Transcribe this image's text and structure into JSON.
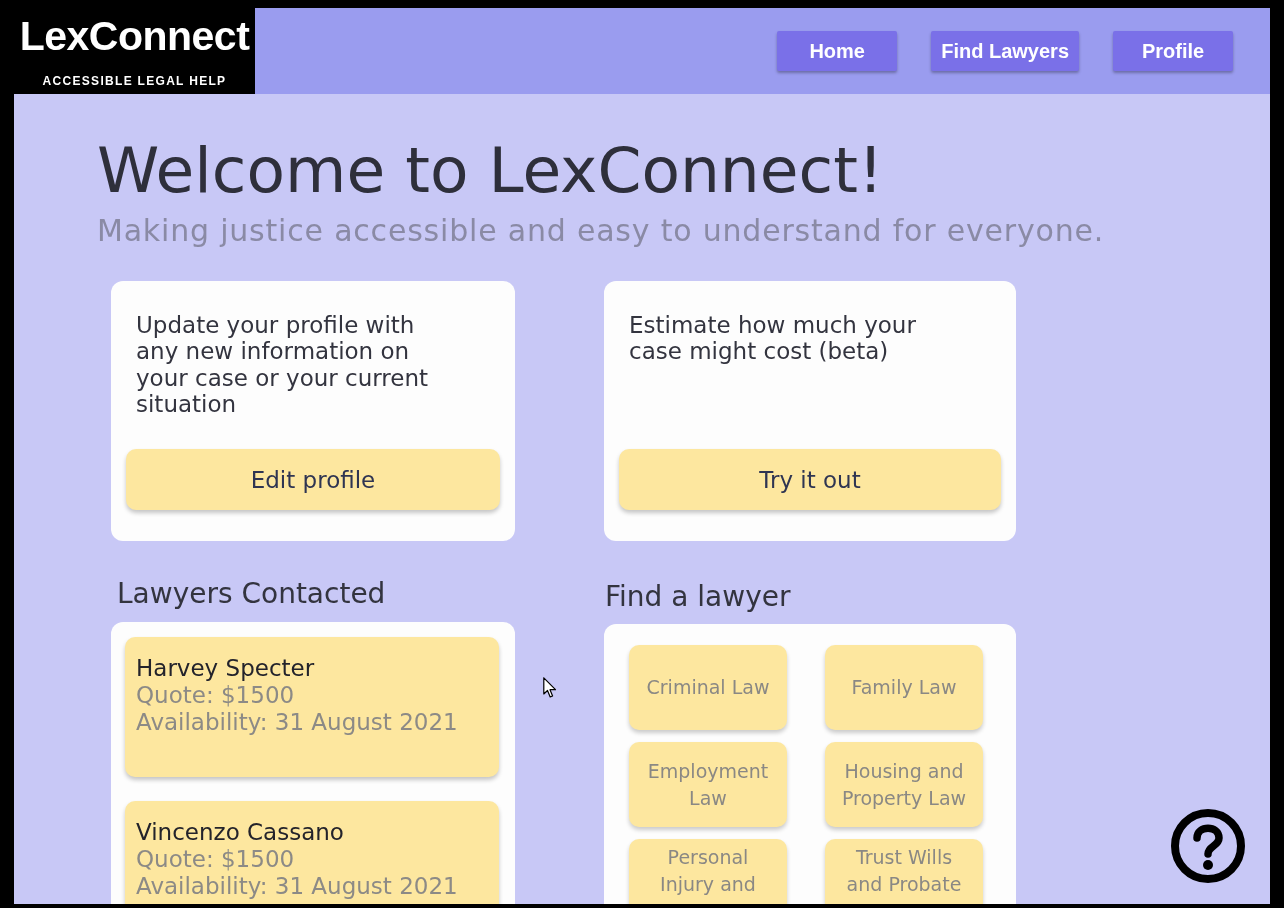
{
  "header": {
    "logo": {
      "name": "LexConnect",
      "tagline": "ACCESSIBLE LEGAL HELP"
    },
    "nav": [
      {
        "label": "Home"
      },
      {
        "label": "Find Lawyers"
      },
      {
        "label": "Profile"
      }
    ]
  },
  "hero": {
    "title": "Welcome to LexConnect!",
    "subtitle": "Making justice accessible and easy to understand for everyone."
  },
  "action_cards": [
    {
      "text": "Update your profile with any new information on your case or your current situation",
      "button": "Edit profile"
    },
    {
      "text": "Estimate how much your case might cost (beta)",
      "button": "Try it out"
    }
  ],
  "lawyers_contacted": {
    "heading": "Lawyers Contacted",
    "lawyers": [
      {
        "name": "Harvey Specter",
        "quote": "Quote: $1500",
        "availability": "Availability: 31 August 2021"
      },
      {
        "name": "Vincenzo Cassano",
        "quote": "Quote: $1500",
        "availability": "Availability: 31 August 2021"
      }
    ]
  },
  "find_lawyer": {
    "heading": "Find a lawyer",
    "categories": [
      "Criminal Law",
      "Family Law",
      "Employment Law",
      "Housing and Property Law",
      "Personal Injury and",
      "Trust Wills and Probate"
    ]
  }
}
